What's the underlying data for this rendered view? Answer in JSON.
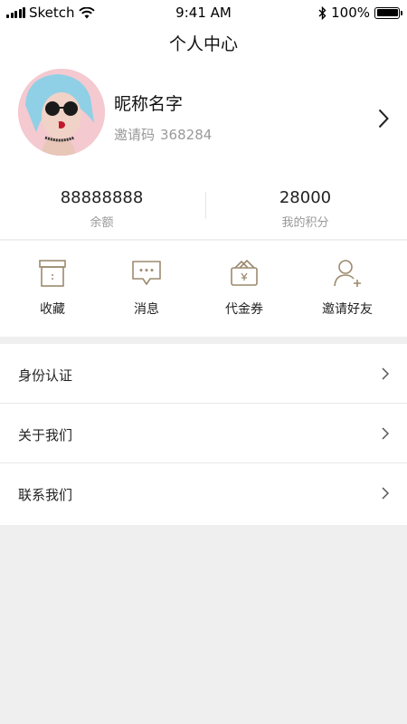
{
  "status_bar": {
    "carrier": "Sketch",
    "time": "9:41 AM",
    "battery": "100%"
  },
  "nav": {
    "title": "个人中心"
  },
  "profile": {
    "nickname": "昵称名字",
    "invite_label": "邀请码",
    "invite_code": "368284"
  },
  "stats": [
    {
      "value": "88888888",
      "label": "余额"
    },
    {
      "value": "28000",
      "label": "我的积分"
    }
  ],
  "quick_actions": [
    {
      "label": "收藏",
      "icon": "archive-box-icon"
    },
    {
      "label": "消息",
      "icon": "message-icon"
    },
    {
      "label": "代金券",
      "icon": "wallet-icon"
    },
    {
      "label": "邀请好友",
      "icon": "add-user-icon"
    }
  ],
  "menu": [
    {
      "label": "身份认证"
    },
    {
      "label": "关于我们"
    },
    {
      "label": "联系我们"
    }
  ],
  "colors": {
    "accent": "#9c8a6e",
    "background": "#efefef",
    "muted_text": "#999999"
  }
}
